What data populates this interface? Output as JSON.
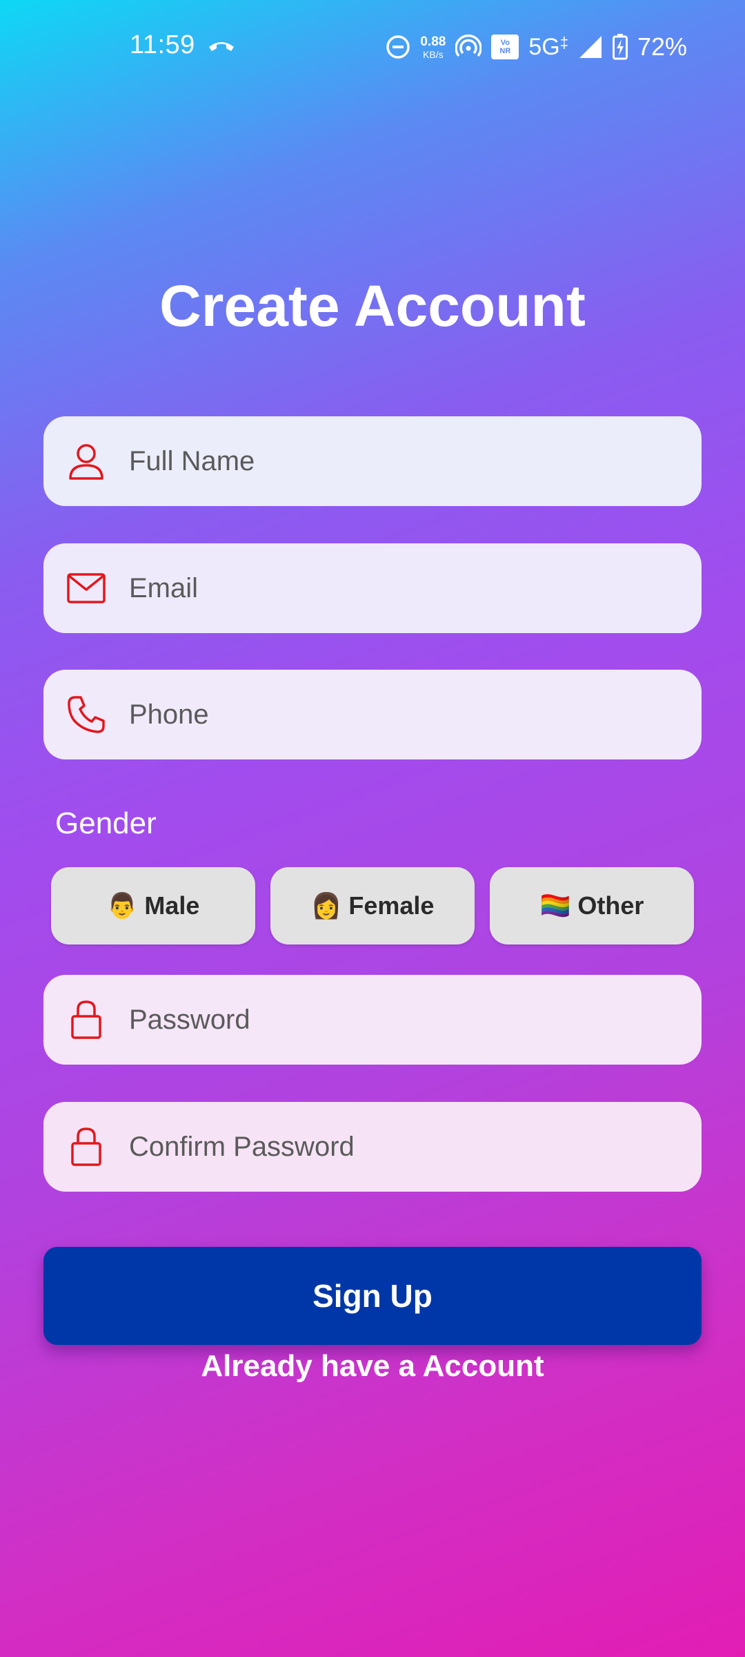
{
  "status_bar": {
    "time": "11:59",
    "net_speed_value": "0.88",
    "net_speed_unit": "KB/s",
    "vonr_top": "Vo",
    "vonr_bottom": "NR",
    "network": "5G",
    "battery": "72%"
  },
  "title": "Create Account",
  "fields": {
    "full_name": {
      "placeholder": "Full Name",
      "icon": "person-icon"
    },
    "email": {
      "placeholder": "Email",
      "icon": "mail-icon"
    },
    "phone": {
      "placeholder": "Phone",
      "icon": "phone-icon"
    },
    "password": {
      "placeholder": "Password",
      "icon": "lock-icon"
    },
    "confirm_password": {
      "placeholder": "Confirm Password",
      "icon": "lock-icon"
    }
  },
  "gender": {
    "label": "Gender",
    "options": [
      {
        "emoji": "👨",
        "label": "Male"
      },
      {
        "emoji": "👩",
        "label": "Female"
      },
      {
        "emoji": "🏳️‍🌈",
        "label": "Other"
      }
    ]
  },
  "signup_label": "Sign Up",
  "login_link": "Already have a Account",
  "colors": {
    "icon_red": "#e3161c",
    "button_blue": "#0037a8"
  }
}
